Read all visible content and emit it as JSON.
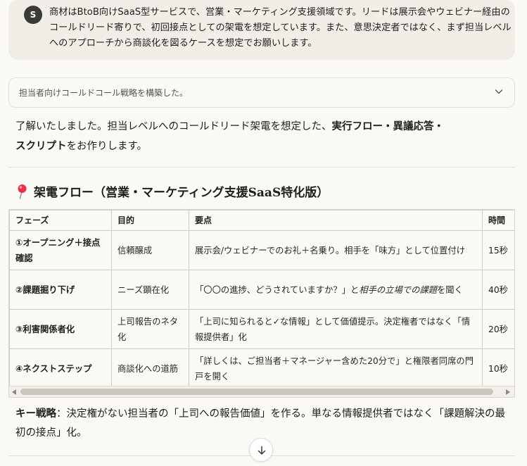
{
  "user_message": {
    "avatar_initial": "S",
    "text": "商材はBtoB向けSaaS型サービスで、営業・マーケティング支援領域です。リードは展示会やウェビナー経由のコールドリード寄りで、初回接点としての架電を想定しています。また、意思決定者ではなく、まず担当レベルへのアプローチから商談化を図るケースを想定でお願いします。"
  },
  "summary": {
    "label": "担当者向けコールドコール戦略を構築した。"
  },
  "intro": {
    "pre": "了解いたしました。担当レベルへのコールドリード架電を想定した、",
    "bold1": "実行フロー・異議応答・",
    "bold2": "スクリプト",
    "post": "をお作りします。"
  },
  "section": {
    "title": "架電フロー（営業・マーケティング支援SaaS特化版）"
  },
  "table": {
    "headers": [
      "フェーズ",
      "目的",
      "要点",
      "時間"
    ],
    "rows": [
      {
        "phase": "①オープニング＋接点確認",
        "purpose": "信頼醸成",
        "point": "展示会/ウェビナーでのお礼＋名乗り。相手を「味方」として位置付け",
        "time": "15秒"
      },
      {
        "phase": "②課題掘り下げ",
        "purpose": "ニーズ顕在化",
        "point_pre": "「〇〇の進捗、どうされていますか？」と",
        "point_em": "相手の立場での課題",
        "point_post": "を聞く",
        "time": "40秒"
      },
      {
        "phase": "③利害関係者化",
        "purpose": "上司報告のネタ化",
        "point": "「上司に知られると✓な情報」として価値提示。決定権者ではなく「情報提供者」化",
        "time": "20秒"
      },
      {
        "phase": "④ネクストステップ",
        "purpose": "商談化への道筋",
        "point": "「詳しくは、ご担当者＋マネージャー含めた20分で」と権限者同席の門戸を開く",
        "time": "10秒"
      }
    ]
  },
  "key_strategy": {
    "label": "キー戦略",
    "text": "：決定権がない担当者の「上司への報告価値」を作る。単なる情報提供者ではなく「課題解決の最初の接点」化。"
  },
  "icons": {
    "pin": "round-pushpin-icon",
    "chevron": "chevron-down-icon",
    "scroll_down": "arrow-down-icon"
  },
  "colors": {
    "background": "#faf9f5",
    "user_bubble": "#f0eee6",
    "pin_red": "#e8334a"
  }
}
